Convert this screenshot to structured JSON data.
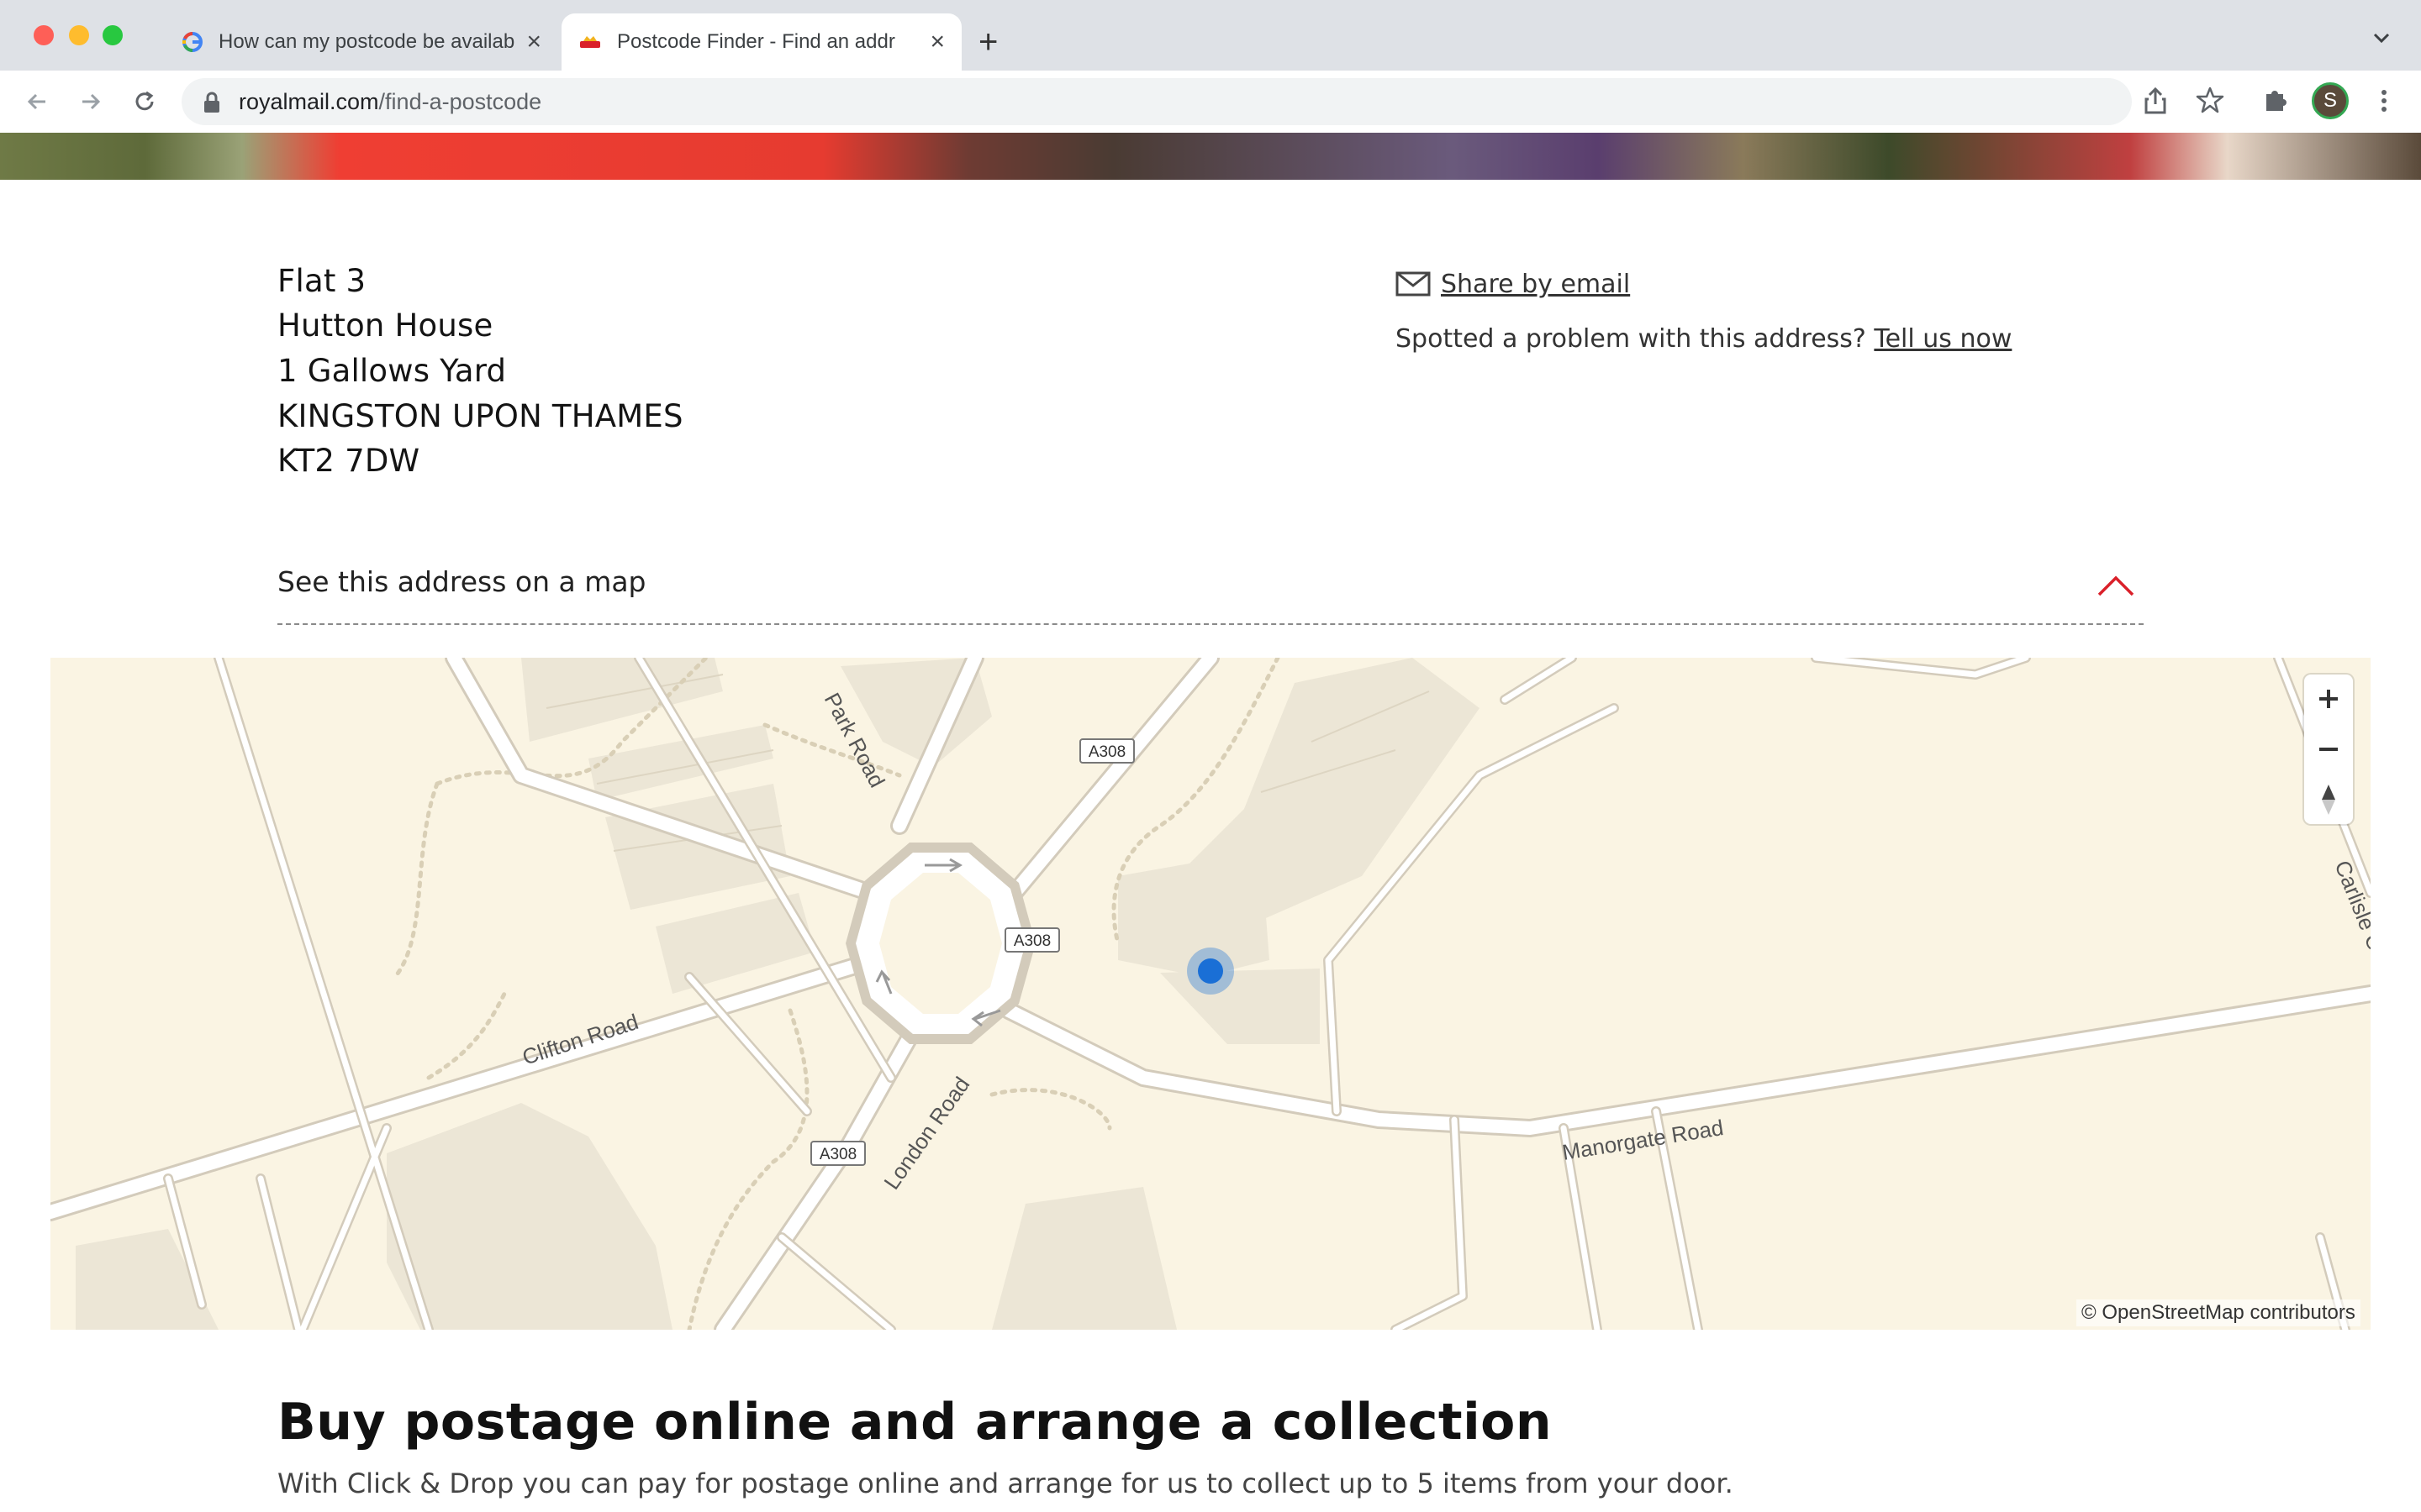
{
  "browser": {
    "tabs": [
      {
        "title": "How can my postcode be availab",
        "favicon": "google-icon",
        "active": false
      },
      {
        "title": "Postcode Finder - Find an addr",
        "favicon": "royal-mail-icon",
        "active": true
      }
    ],
    "new_tab_icon": "plus-icon",
    "url_host": "royalmail.com",
    "url_path": "/find-a-postcode",
    "profile_initial": "S"
  },
  "address": {
    "lines": [
      "Flat 3",
      "Hutton House",
      "1 Gallows Yard",
      "KINGSTON UPON THAMES",
      "KT2 7DW"
    ]
  },
  "actions": {
    "share_label": "Share by email",
    "problem_text": "Spotted a problem with this address? ",
    "tell_label": "Tell us now"
  },
  "map_section": {
    "heading": "See this address on a map",
    "attribution": "© OpenStreetMap contributors",
    "road_labels": {
      "park_road": "Park Road",
      "clifton_road": "Clifton Road",
      "london_road": "London Road",
      "manorgate_road": "Manorgate Road",
      "carlisle_close": "Carlisle Close",
      "a308": "A308"
    }
  },
  "promo": {
    "title": "Buy postage online and arrange a collection",
    "body": "With Click & Drop you can pay for postage online and arrange for us to collect up to 5 items from your door."
  },
  "colors": {
    "accent_red": "#da202a",
    "marker_blue": "#1a6fd6",
    "map_bg": "#faf4e3"
  }
}
